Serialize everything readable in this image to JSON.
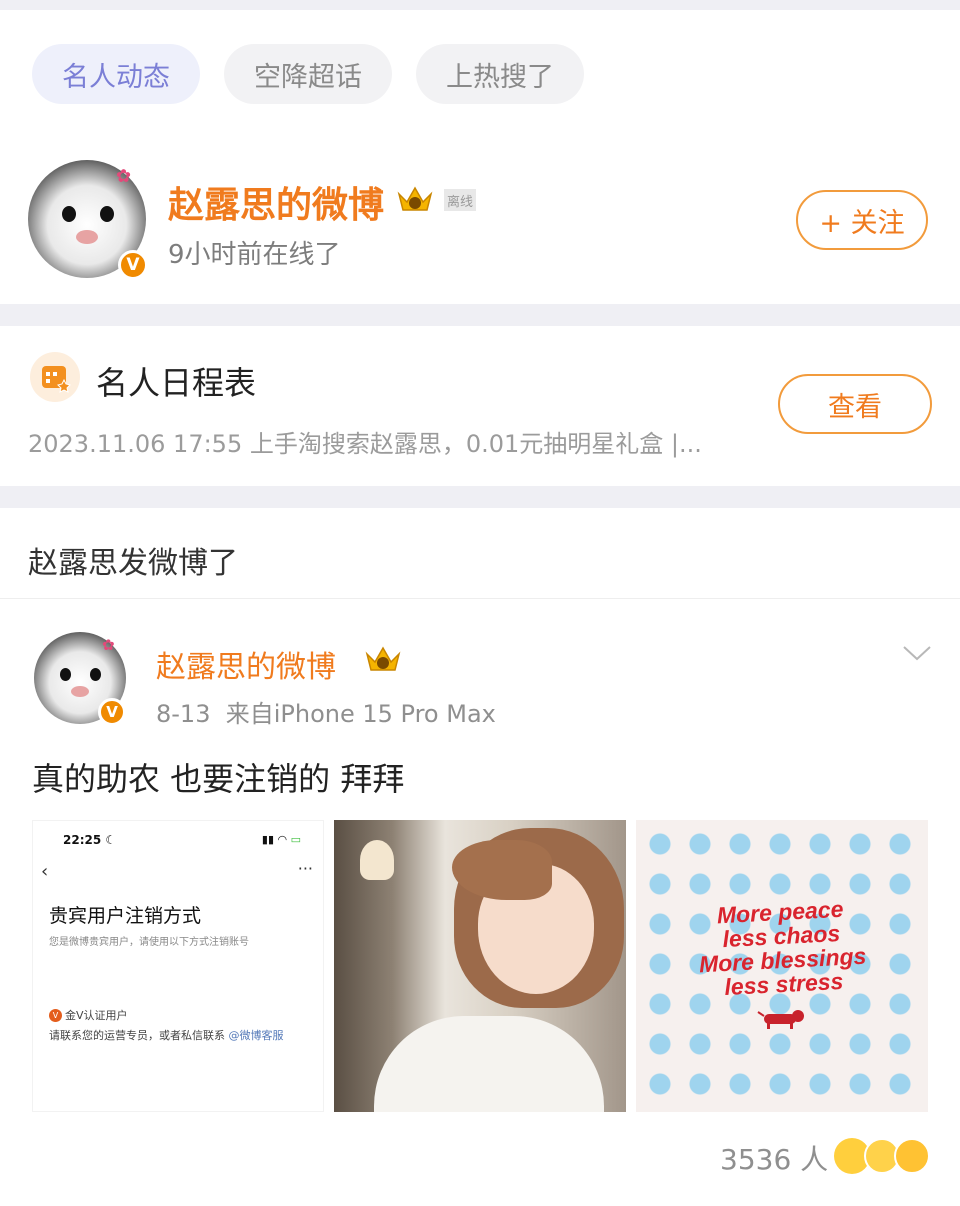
{
  "tabs": [
    {
      "label": "名人动态",
      "active": true
    },
    {
      "label": "空降超话",
      "active": false
    },
    {
      "label": "上热搜了",
      "active": false
    }
  ],
  "profile": {
    "name": "赵露思的微博",
    "status_tag": "离线",
    "online_text": "9小时前在线了",
    "follow_label": "+ 关注"
  },
  "schedule": {
    "title": "名人日程表",
    "detail": "2023.11.06 17:55 上手淘搜索赵露思，0.01元抽明星礼盒 |...",
    "view_label": "查看"
  },
  "section_title": "赵露思发微博了",
  "post": {
    "author": "赵露思的微博",
    "date": "8-13",
    "source": "来自iPhone 15 Pro Max",
    "text": "真的助农 也要注销的 拜拜",
    "images": {
      "screenshot": {
        "time": "22:25",
        "title": "贵宾用户注销方式",
        "subtitle": "您是微博贵宾用户，请使用以下方式注销账号",
        "label": "金V认证用户",
        "contact_text": "请联系您的运营专员，或者私信联系",
        "contact_link": "@微博客服"
      },
      "poster_lines": [
        "More peace",
        "less chaos",
        "More blessings",
        "less stress"
      ]
    },
    "reactions_count": "3536 人"
  },
  "colors": {
    "accent_orange": "#f07b1e",
    "chip_active_text": "#7b7fd6",
    "poster_dot": "#9fd4ee",
    "poster_text": "#d9242e"
  }
}
